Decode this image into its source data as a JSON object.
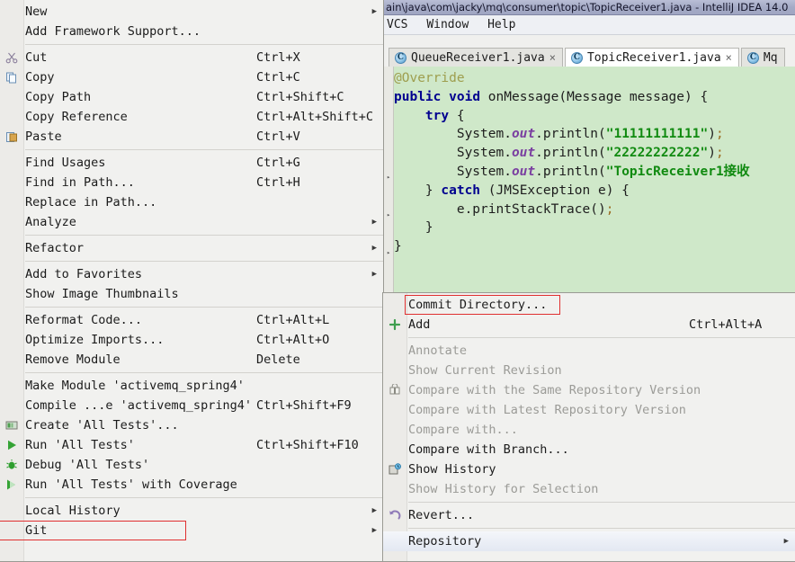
{
  "ide": {
    "title": "ain\\java\\com\\jacky\\mq\\consumer\\topic\\TopicReceiver1.java - IntelliJ IDEA 14.0",
    "menu_bar": [
      "VCS",
      "Window",
      "Help"
    ],
    "tabs": [
      {
        "label": "QueueReceiver1.java",
        "icon": "java-class-icon",
        "close": "×",
        "active": false
      },
      {
        "label": "TopicReceiver1.java",
        "icon": "java-class-icon",
        "close": "×",
        "active": true
      },
      {
        "label": "Mq",
        "icon": "java-class-icon",
        "close": "",
        "active": false
      }
    ],
    "code_lines": [
      {
        "indent": 0,
        "tokens": [
          {
            "t": "@Override",
            "c": "ann"
          }
        ]
      },
      {
        "indent": 0,
        "tokens": [
          {
            "t": "public",
            "c": "k"
          },
          {
            "t": " ",
            "c": "pn"
          },
          {
            "t": "void",
            "c": "k"
          },
          {
            "t": " onMessage(Message message) {",
            "c": "pn"
          }
        ]
      },
      {
        "indent": 1,
        "tokens": [
          {
            "t": "try",
            "c": "k"
          },
          {
            "t": " {",
            "c": "pn"
          }
        ]
      },
      {
        "indent": 2,
        "tokens": [
          {
            "t": "System.",
            "c": "pn"
          },
          {
            "t": "out",
            "c": "fld"
          },
          {
            "t": ".println(",
            "c": "pn"
          },
          {
            "t": "\"11111111111\"",
            "c": "str"
          },
          {
            "t": ")",
            "c": "pn"
          },
          {
            "t": ";",
            "c": "semi"
          }
        ]
      },
      {
        "indent": 2,
        "tokens": [
          {
            "t": "System.",
            "c": "pn"
          },
          {
            "t": "out",
            "c": "fld"
          },
          {
            "t": ".println(",
            "c": "pn"
          },
          {
            "t": "\"22222222222\"",
            "c": "str"
          },
          {
            "t": ")",
            "c": "pn"
          },
          {
            "t": ";",
            "c": "semi"
          }
        ]
      },
      {
        "indent": 2,
        "tokens": [
          {
            "t": "System.",
            "c": "pn"
          },
          {
            "t": "out",
            "c": "fld"
          },
          {
            "t": ".println(",
            "c": "pn"
          },
          {
            "t": "\"TopicReceiver1接收",
            "c": "str"
          }
        ]
      },
      {
        "indent": 1,
        "tokens": [
          {
            "t": "} ",
            "c": "pn"
          },
          {
            "t": "catch",
            "c": "k"
          },
          {
            "t": " (JMSException e) {",
            "c": "pn"
          }
        ]
      },
      {
        "indent": 2,
        "tokens": [
          {
            "t": "e.printStackTrace()",
            "c": "pn"
          },
          {
            "t": ";",
            "c": "semi"
          }
        ]
      },
      {
        "indent": 1,
        "tokens": [
          {
            "t": "}",
            "c": "pn"
          }
        ]
      },
      {
        "indent": 0,
        "tokens": [
          {
            "t": "}",
            "c": "pn"
          }
        ]
      }
    ]
  },
  "context_menu": {
    "items": [
      {
        "label": "New",
        "accel": "",
        "arrow": true,
        "icon": "",
        "group": 0
      },
      {
        "label": "Add Framework Support...",
        "accel": "",
        "arrow": false,
        "icon": "",
        "group": 0
      },
      {
        "label": "Cut",
        "accel": "Ctrl+X",
        "arrow": false,
        "icon": "scissors-icon",
        "group": 1
      },
      {
        "label": "Copy",
        "accel": "Ctrl+C",
        "arrow": false,
        "icon": "copy-icon",
        "group": 1
      },
      {
        "label": "Copy Path",
        "accel": "Ctrl+Shift+C",
        "arrow": false,
        "icon": "",
        "group": 1
      },
      {
        "label": "Copy Reference",
        "accel": "Ctrl+Alt+Shift+C",
        "arrow": false,
        "icon": "",
        "group": 1
      },
      {
        "label": "Paste",
        "accel": "Ctrl+V",
        "arrow": false,
        "icon": "paste-icon",
        "group": 1
      },
      {
        "label": "Find Usages",
        "accel": "Ctrl+G",
        "arrow": false,
        "icon": "",
        "group": 2
      },
      {
        "label": "Find in Path...",
        "accel": "Ctrl+H",
        "arrow": false,
        "icon": "",
        "group": 2
      },
      {
        "label": "Replace in Path...",
        "accel": "",
        "arrow": false,
        "icon": "",
        "group": 2
      },
      {
        "label": "Analyze",
        "accel": "",
        "arrow": true,
        "icon": "",
        "group": 2
      },
      {
        "label": "Refactor",
        "accel": "",
        "arrow": true,
        "icon": "",
        "group": 3
      },
      {
        "label": "Add to Favorites",
        "accel": "",
        "arrow": true,
        "icon": "",
        "group": 4
      },
      {
        "label": "Show Image Thumbnails",
        "accel": "",
        "arrow": false,
        "icon": "",
        "group": 4
      },
      {
        "label": "Reformat Code...",
        "accel": "Ctrl+Alt+L",
        "arrow": false,
        "icon": "",
        "group": 5
      },
      {
        "label": "Optimize Imports...",
        "accel": "Ctrl+Alt+O",
        "arrow": false,
        "icon": "",
        "group": 5
      },
      {
        "label": "Remove Module",
        "accel": "Delete",
        "arrow": false,
        "icon": "",
        "group": 5
      },
      {
        "label": "Make Module 'activemq_spring4'",
        "accel": "",
        "arrow": false,
        "icon": "",
        "group": 6
      },
      {
        "label": "Compile ...e 'activemq_spring4'",
        "accel": "Ctrl+Shift+F9",
        "arrow": false,
        "icon": "",
        "group": 6
      },
      {
        "label": "Create 'All Tests'...",
        "accel": "",
        "arrow": false,
        "icon": "test-config-icon",
        "group": 6
      },
      {
        "label": "Run 'All Tests'",
        "accel": "Ctrl+Shift+F10",
        "arrow": false,
        "icon": "run-icon",
        "group": 6
      },
      {
        "label": "Debug 'All Tests'",
        "accel": "",
        "arrow": false,
        "icon": "debug-icon",
        "group": 6
      },
      {
        "label": "Run 'All Tests' with Coverage",
        "accel": "",
        "arrow": false,
        "icon": "coverage-icon",
        "group": 6
      },
      {
        "label": "Local History",
        "accel": "",
        "arrow": true,
        "icon": "",
        "group": 7
      },
      {
        "label": "Git",
        "accel": "",
        "arrow": true,
        "icon": "",
        "group": 7,
        "highlighted": true
      }
    ]
  },
  "git_submenu": {
    "items": [
      {
        "label": "Commit Directory...",
        "accel": "",
        "arrow": false,
        "icon": "",
        "disabled": false,
        "highlighted": true
      },
      {
        "label": "Add",
        "accel": "Ctrl+Alt+A",
        "arrow": false,
        "icon": "plus-icon",
        "disabled": false
      },
      {
        "label": "Annotate",
        "accel": "",
        "arrow": false,
        "icon": "",
        "disabled": true,
        "sep_before": true
      },
      {
        "label": "Show Current Revision",
        "accel": "",
        "arrow": false,
        "icon": "",
        "disabled": true
      },
      {
        "label": "Compare with the Same Repository Version",
        "accel": "",
        "arrow": false,
        "icon": "compare-icon",
        "disabled": true
      },
      {
        "label": "Compare with Latest Repository Version",
        "accel": "",
        "arrow": false,
        "icon": "",
        "disabled": true
      },
      {
        "label": "Compare with...",
        "accel": "",
        "arrow": false,
        "icon": "",
        "disabled": true
      },
      {
        "label": "Compare with Branch...",
        "accel": "",
        "arrow": false,
        "icon": "",
        "disabled": false
      },
      {
        "label": "Show History",
        "accel": "",
        "arrow": false,
        "icon": "history-icon",
        "disabled": false
      },
      {
        "label": "Show History for Selection",
        "accel": "",
        "arrow": false,
        "icon": "",
        "disabled": true
      },
      {
        "label": "Revert...",
        "accel": "",
        "arrow": false,
        "icon": "revert-icon",
        "disabled": false,
        "sep_before": true
      },
      {
        "label": "Repository",
        "accel": "",
        "arrow": true,
        "icon": "",
        "disabled": false,
        "sep_before": true,
        "selected": true
      }
    ]
  },
  "colors": {
    "menu_bg": "#f1f1ef",
    "editor_bg": "#cfe8c9",
    "highlight_red": "#e03030",
    "title_bar": "#a5abc6"
  }
}
